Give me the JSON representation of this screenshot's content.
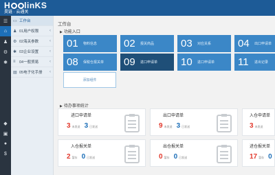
{
  "header": {
    "brand": "H",
    "brand_tail": "linKS",
    "subtitle": "昊链 · 云通关"
  },
  "rail": [
    "menu-icon",
    "home-icon",
    "users-icon",
    "settings-icon",
    "gear-icon",
    "shield-icon",
    "money-icon",
    "user-icon",
    "dollar-icon"
  ],
  "sidebar": {
    "header": "工作台",
    "items": [
      {
        "label": "01用户权限"
      },
      {
        "label": "02海关参数"
      },
      {
        "label": "03企业设置"
      },
      {
        "label": "04一般贸易"
      },
      {
        "label": "05电子化手册"
      }
    ]
  },
  "main": {
    "title": "工作台",
    "entry_title": "功能入口",
    "tiles": [
      {
        "num": "01",
        "label": "物料信息"
      },
      {
        "num": "02",
        "label": "报关商品"
      },
      {
        "num": "03",
        "label": "对应关系"
      },
      {
        "num": "04",
        "label": "出口申请单"
      },
      {
        "num": "08",
        "label": "保税仓报关单"
      },
      {
        "num": "09",
        "label": "进口申请单"
      },
      {
        "num": "10",
        "label": "进口申请单"
      },
      {
        "num": "11",
        "label": "进出记录"
      }
    ],
    "add_button": "添加组件",
    "stats_title": "待办事项统计",
    "cards": [
      {
        "title": "进口申请单",
        "a": "3",
        "a_unit": "未发送",
        "b": "3",
        "b_unit": "已发送"
      },
      {
        "title": "出口申请单",
        "a": "9",
        "a_unit": "未发送",
        "b": "3",
        "b_unit": "已发送"
      },
      {
        "title": "入仓申请单",
        "a": "3",
        "a_unit": "未发送",
        "b": "",
        "b_unit": ""
      },
      {
        "title": "入仓报关单",
        "a": "2",
        "a_unit": "暂存",
        "b": "0",
        "b_unit": "已发送"
      },
      {
        "title": "出仓报关单",
        "a": "0",
        "a_unit": "暂存",
        "b": "0",
        "b_unit": "已发送"
      },
      {
        "title": "进仓报关单",
        "a": "17",
        "a_unit": "暂存",
        "b": "0",
        "b_unit": ""
      }
    ]
  },
  "colors": {
    "topbar": "#1d5b97",
    "tile": "#3b87c7",
    "tile_dark": "#1f4f78",
    "rail": "#2a3440",
    "red": "#e23a2e",
    "blue": "#1d6fb8"
  }
}
